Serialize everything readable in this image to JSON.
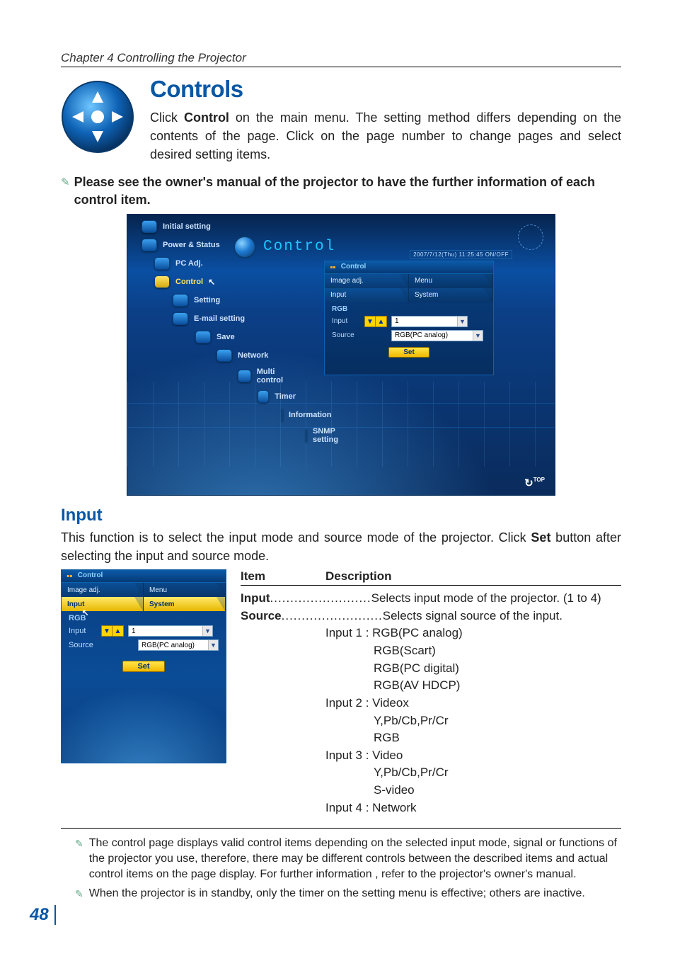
{
  "chapter_header": "Chapter 4 Controlling the Projector",
  "title": "Controls",
  "intro": {
    "text_pre": "Click ",
    "bold": "Control",
    "text_post": " on the main menu. The setting method differs depending on the contents of the page. Click on the page number to change pages and select desired setting items."
  },
  "note1": "Please see the owner's manual of the projector to have the further information of each control item.",
  "shot": {
    "title": "Control",
    "datetime": "2007/7/12(Thu) 11:25:45  ON/OFF",
    "refresh_label": "TOP",
    "sidebar": [
      {
        "label": "Initial setting",
        "indent": 0
      },
      {
        "label": "Power & Status",
        "indent": 0
      },
      {
        "label": "PC Adj.",
        "indent": 1
      },
      {
        "label": "Control",
        "indent": 1,
        "selected": true,
        "cursor": true
      },
      {
        "label": "Setting",
        "indent": 2
      },
      {
        "label": "E-mail setting",
        "indent": 2
      },
      {
        "label": "Save",
        "indent": 3
      },
      {
        "label": "Network",
        "indent": 4
      },
      {
        "label": "Multi control",
        "indent": 5
      },
      {
        "label": "Timer",
        "indent": 6
      },
      {
        "label": "Information",
        "indent": 7
      },
      {
        "label": "SNMP setting",
        "indent": 8
      }
    ],
    "panel": {
      "head": "Control",
      "tabs_row1": [
        "Image adj.",
        "Menu"
      ],
      "tabs_row2": [
        "Input",
        "System"
      ],
      "group": "RGB",
      "rows": {
        "input_label": "Input",
        "input_value": "1",
        "source_label": "Source",
        "source_value": "RGB(PC analog)"
      },
      "set": "Set"
    }
  },
  "input_section": {
    "heading": "Input",
    "para_pre": "This function is to select the input mode and source mode of the projector.  Click ",
    "para_bold": "Set",
    "para_post": " button after selecting the input and source mode.",
    "mini_panel": {
      "head": "Control",
      "tabs_row1": [
        "Image adj.",
        "Menu"
      ],
      "tabs_row2": [
        "Input",
        "System"
      ],
      "group": "RGB",
      "rows": {
        "input_label": "Input",
        "input_value": "1",
        "source_label": "Source",
        "source_value": "RGB(PC analog)"
      },
      "set": "Set"
    },
    "table": {
      "col1": "Item",
      "col2": "Description",
      "input_key": "Input",
      "input_val": "Selects input mode of the projector. (1 to 4)",
      "source_key": "Source",
      "source_val": "Selects signal source of the input.",
      "groups": [
        {
          "label": "Input 1 : RGB(PC analog)",
          "subs": [
            "RGB(Scart)",
            "RGB(PC digital)",
            "RGB(AV HDCP)"
          ]
        },
        {
          "label": "Input 2 : Videox",
          "subs": [
            "Y,Pb/Cb,Pr/Cr",
            "RGB"
          ]
        },
        {
          "label": "Input 3 : Video",
          "subs": [
            "Y,Pb/Cb,Pr/Cr",
            "S-video"
          ]
        },
        {
          "label": "Input 4 : Network",
          "subs": []
        }
      ]
    }
  },
  "footnotes": [
    "The control page displays valid control items depending on the selected input mode, signal or  functions of the projector you use, therefore, there may be different controls between the described items and actual control items on the page display. For further information , refer to the projector's owner's manual.",
    "When the projector is in standby, only the timer on the setting menu is effective; others are inactive."
  ],
  "page_number": "48"
}
